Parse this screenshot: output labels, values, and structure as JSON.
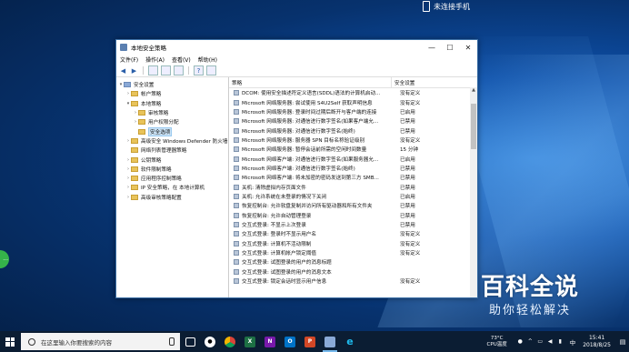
{
  "phone_status": "未连接手机",
  "watermark": {
    "main": "百科全说",
    "sub": "助你轻松解决"
  },
  "left_bubble": "...",
  "window": {
    "title": "本地安全策略",
    "menu": [
      "文件(F)",
      "操作(A)",
      "查看(V)",
      "帮助(H)"
    ],
    "controls": {
      "min": "—",
      "max": "☐",
      "close": "✕"
    },
    "tree": [
      {
        "label": "安全设置",
        "indent": 0,
        "arrow": "▾",
        "icon": "shield"
      },
      {
        "label": "帐户策略",
        "indent": 1,
        "arrow": "›",
        "icon": "folder"
      },
      {
        "label": "本地策略",
        "indent": 1,
        "arrow": "▾",
        "icon": "folder"
      },
      {
        "label": "审核策略",
        "indent": 2,
        "arrow": "›",
        "icon": "folder"
      },
      {
        "label": "用户权限分配",
        "indent": 2,
        "arrow": "›",
        "icon": "folder"
      },
      {
        "label": "安全选项",
        "indent": 2,
        "arrow": "",
        "icon": "folder",
        "selected": true
      },
      {
        "label": "高级安全 Windows Defender 防火墙",
        "indent": 1,
        "arrow": "›",
        "icon": "folder"
      },
      {
        "label": "网络列表管理器策略",
        "indent": 1,
        "arrow": "",
        "icon": "folder"
      },
      {
        "label": "公钥策略",
        "indent": 1,
        "arrow": "›",
        "icon": "folder"
      },
      {
        "label": "软件限制策略",
        "indent": 1,
        "arrow": "›",
        "icon": "folder"
      },
      {
        "label": "应用程序控制策略",
        "indent": 1,
        "arrow": "›",
        "icon": "folder"
      },
      {
        "label": "IP 安全策略，在 本地计算机",
        "indent": 1,
        "arrow": "›",
        "icon": "folder"
      },
      {
        "label": "高级审核策略配置",
        "indent": 1,
        "arrow": "›",
        "icon": "folder"
      }
    ],
    "list_headers": {
      "policy": "策略",
      "setting": "安全设置"
    },
    "rows": [
      {
        "name": "DCOM: 使用安全描述符定义语言(SDDL)语法的计算机启动...",
        "value": "没有定义"
      },
      {
        "name": "Microsoft 网络服务器: 尝试使用 S4U2Self 获取声明信息",
        "value": "没有定义"
      },
      {
        "name": "Microsoft 网络服务器: 登录时间过期后断开与客户端的连接",
        "value": "已启用"
      },
      {
        "name": "Microsoft 网络服务器: 对通信进行数字签名(如果客户端允...",
        "value": "已禁用"
      },
      {
        "name": "Microsoft 网络服务器: 对通信进行数字签名(始终)",
        "value": "已禁用"
      },
      {
        "name": "Microsoft 网络服务器: 服务器 SPN 目标名称验证级别",
        "value": "没有定义"
      },
      {
        "name": "Microsoft 网络服务器: 暂停会话前所需的空闲时间数量",
        "value": "15 分钟"
      },
      {
        "name": "Microsoft 网络客户端: 对通信进行数字签名(如果服务器允...",
        "value": "已启用"
      },
      {
        "name": "Microsoft 网络客户端: 对通信进行数字签名(始终)",
        "value": "已禁用"
      },
      {
        "name": "Microsoft 网络客户端: 将未加密的密码发送到第三方 SMB...",
        "value": "已禁用"
      },
      {
        "name": "关机: 清除虚拟内存页面文件",
        "value": "已禁用"
      },
      {
        "name": "关机: 允许系统在未登录的情况下关闭",
        "value": "已启用"
      },
      {
        "name": "恢复控制台: 允许软盘复制并访问所有驱动器和所有文件夹",
        "value": "已禁用"
      },
      {
        "name": "恢复控制台: 允许自动管理登录",
        "value": "已禁用"
      },
      {
        "name": "交互式登录: 不显示上次登录",
        "value": "已禁用"
      },
      {
        "name": "交互式登录: 登录时不显示用户名",
        "value": "没有定义"
      },
      {
        "name": "交互式登录: 计算机不活动限制",
        "value": "没有定义"
      },
      {
        "name": "交互式登录: 计算机帐户锁定阈值",
        "value": "没有定义"
      },
      {
        "name": "交互式登录: 试图登录的用户的消息标题",
        "value": ""
      },
      {
        "name": "交互式登录: 试图登录的用户的消息文本",
        "value": ""
      },
      {
        "name": "交互式登录: 锁定会话时显示用户信息",
        "value": "没有定义"
      }
    ]
  },
  "taskbar": {
    "search_placeholder": "在这里输入你要搜索的内容",
    "apps": [
      "task-view",
      "panda",
      "chrome",
      "excel",
      "onenote",
      "outlook",
      "powerpoint",
      "security-policy",
      "ie"
    ],
    "temp": "73°C",
    "temp_label": "CPU温度",
    "ime": "中",
    "time": "15:41",
    "date": "2018/8/25"
  }
}
